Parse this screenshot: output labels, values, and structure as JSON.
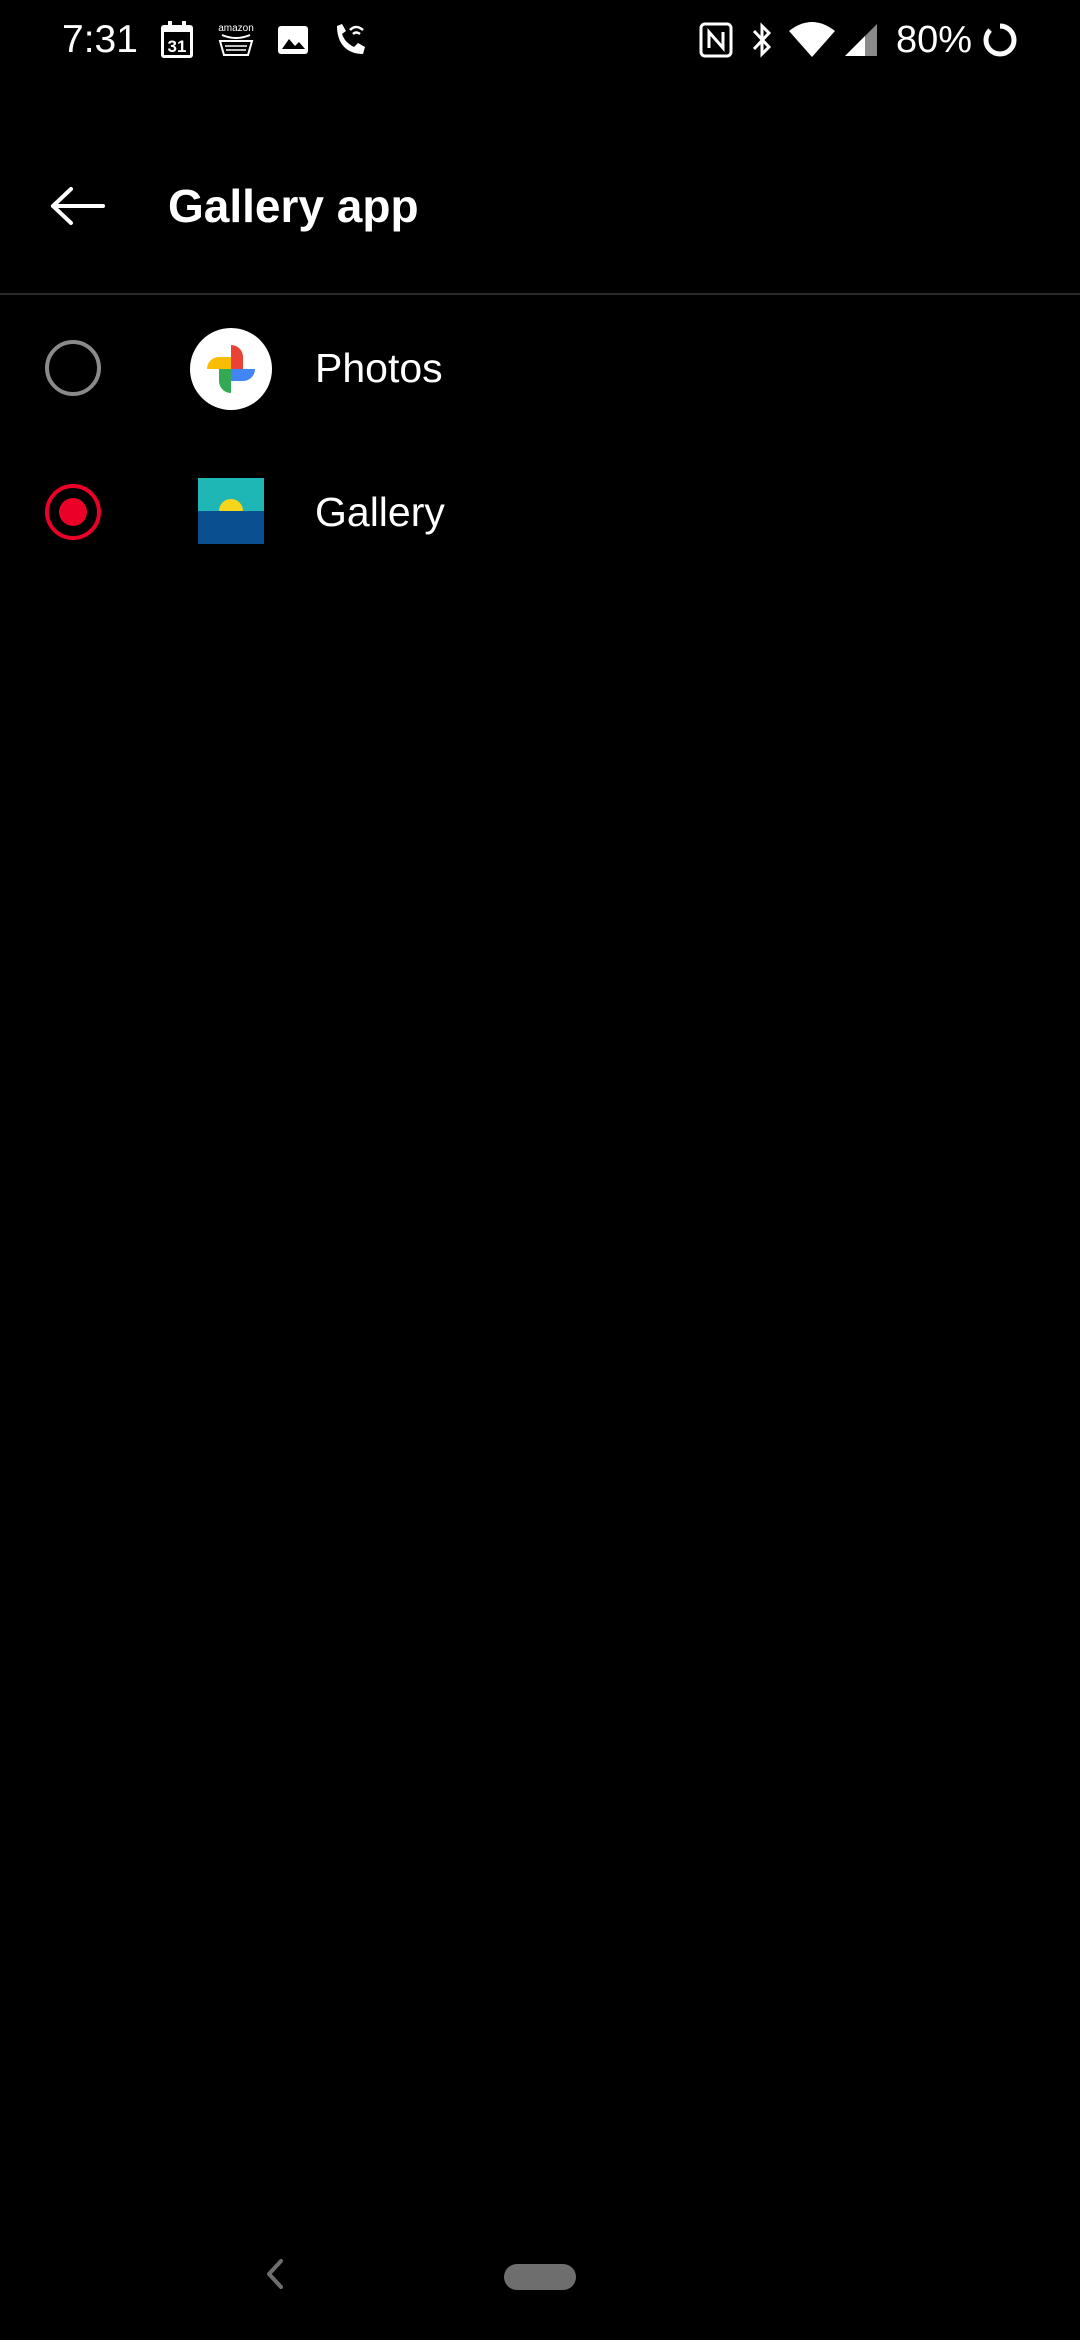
{
  "status_bar": {
    "time": "7:31",
    "calendar_day": "31",
    "amazon_text": "amazon",
    "battery_percent": "80%",
    "icons": [
      "calendar-icon",
      "amazon-icon",
      "gallery-notification-icon",
      "wifi-calling-icon",
      "nfc-icon",
      "bluetooth-icon",
      "wifi-icon",
      "signal-icon",
      "battery-icon"
    ]
  },
  "app_bar": {
    "title": "Gallery app",
    "back_icon": "arrow-left-icon"
  },
  "options": [
    {
      "label": "Photos",
      "icon": "google-photos-icon",
      "selected": false
    },
    {
      "label": "Gallery",
      "icon": "gallery-app-icon",
      "selected": true
    }
  ],
  "colors": {
    "background": "#000000",
    "accent": "#eb0028",
    "radio_unchecked": "#8a8a8a",
    "divider": "#2a2a2a"
  },
  "nav_bar": {
    "back_icon": "chevron-left-icon",
    "home_pill": "home-pill"
  }
}
